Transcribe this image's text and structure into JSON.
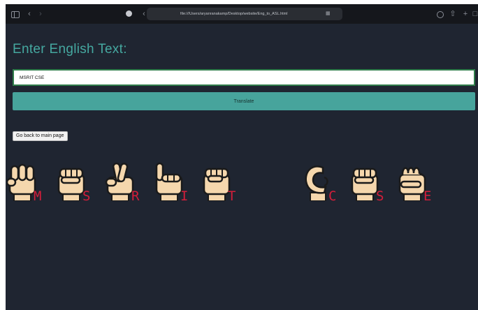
{
  "browser": {
    "url": "file:///Users/aryanranakamp/Desktop/website/Eng_to_ASL.html",
    "icons": [
      "sidebar-icon",
      "back-icon",
      "forward-icon",
      "shield-icon",
      "translate-icon",
      "share-icon",
      "add-tab-icon",
      "tabs-icon"
    ]
  },
  "page": {
    "heading": "Enter English Text:",
    "input_value": "MSRIT CSE",
    "translate_label": "Translate",
    "back_label": "Go back to main page"
  },
  "signs": [
    {
      "letter": "M",
      "handshape": "m"
    },
    {
      "letter": "S",
      "handshape": "fist"
    },
    {
      "letter": "R",
      "handshape": "r"
    },
    {
      "letter": "I",
      "handshape": "i"
    },
    {
      "letter": "T",
      "handshape": "fist"
    },
    {
      "letter": "C",
      "handshape": "c"
    },
    {
      "letter": "S",
      "handshape": "fist"
    },
    {
      "letter": "E",
      "handshape": "e"
    }
  ],
  "colors": {
    "background": "#1f2531",
    "accent": "#47a49c",
    "heading": "#45a8a0",
    "letters": "#d21e3a",
    "skin": "#f5d7ad"
  }
}
